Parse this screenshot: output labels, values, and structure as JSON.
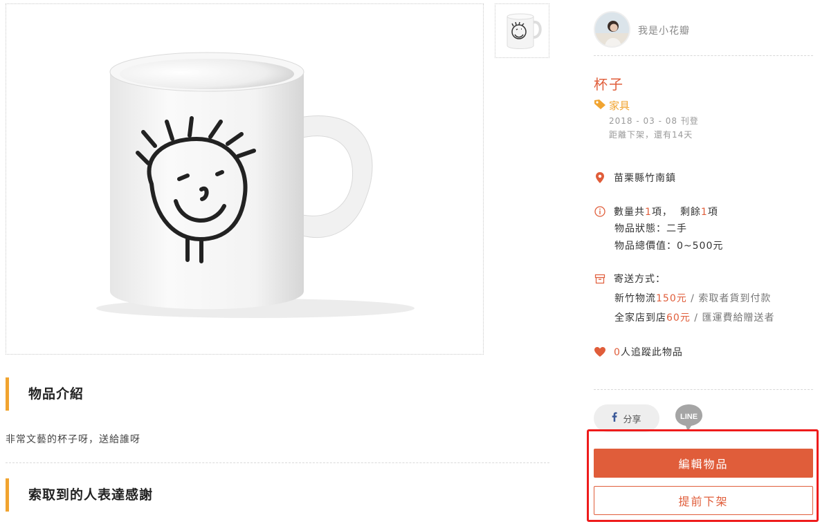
{
  "owner": {
    "name": "我是小花瓣"
  },
  "item": {
    "title": "杯子",
    "category": "家具",
    "posted": "2018 - 03 - 08 刊登",
    "expires": "距離下架，還有14天",
    "location": "苗栗縣竹南鎮",
    "quantity_prefix": "數量共",
    "quantity_total": "1",
    "quantity_mid": "項，  剩餘",
    "quantity_remaining": "1",
    "quantity_suffix": "項",
    "condition": "物品狀態：二手",
    "total_value": "物品總價值：0~500元",
    "shipping_label": "寄送方式：",
    "shipping": [
      {
        "method": "新竹物流",
        "price": "150元",
        "sep": " / ",
        "note": "索取者貨到付款"
      },
      {
        "method": "全家店到店",
        "price": "60元",
        "sep": " / ",
        "note": "匯運費給贈送者"
      }
    ],
    "followers_count": "0",
    "followers_text": "人追蹤此物品"
  },
  "sections": {
    "intro_title": "物品介紹",
    "intro_text": "非常文藝的杯子呀，送給誰呀",
    "thanks_title": "索取到的人表達感謝"
  },
  "actions": {
    "share_label": "分享",
    "line_label": "LINE",
    "edit_label": "編輯物品",
    "unlist_label": "提前下架"
  },
  "colors": {
    "accent": "#e05d3a",
    "tag": "#f1a430",
    "highlight_frame": "#ee1b1b"
  },
  "icons": {
    "category": "tag-icon",
    "location": "map-pin-icon",
    "info": "info-circle-icon",
    "shipping": "box-icon",
    "followers": "heart-icon",
    "share": "facebook-icon",
    "line": "line-icon"
  }
}
